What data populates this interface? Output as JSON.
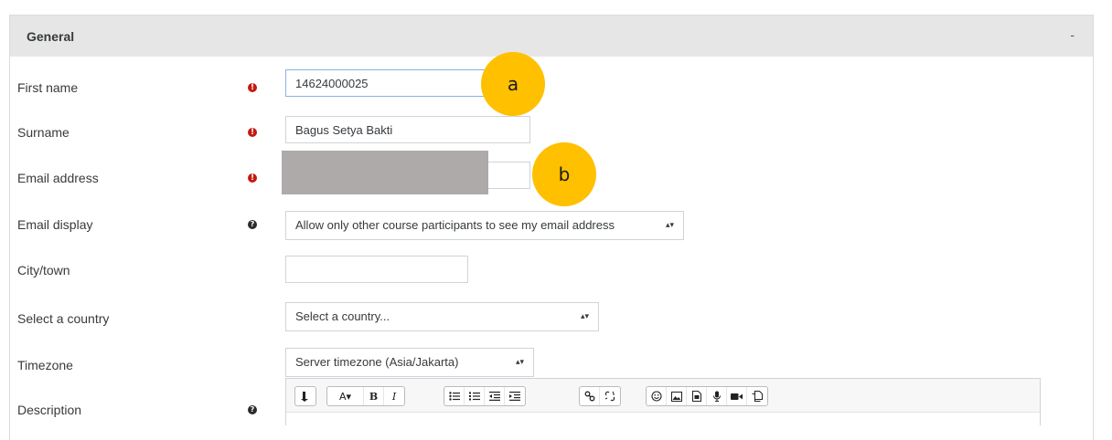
{
  "section": {
    "title": "General",
    "collapse_symbol": "-"
  },
  "fields": {
    "first_name": {
      "label": "First name",
      "value": "14624000025"
    },
    "surname": {
      "label": "Surname",
      "value": "Bagus Setya Bakti"
    },
    "email_address": {
      "label": "Email address"
    },
    "email_display": {
      "label": "Email display",
      "selected": "Allow only other course participants to see my email address"
    },
    "city": {
      "label": "City/town",
      "value": ""
    },
    "country": {
      "label": "Select a country",
      "selected": "Select a country..."
    },
    "timezone": {
      "label": "Timezone",
      "selected": "Server timezone (Asia/Jakarta)"
    },
    "description": {
      "label": "Description"
    }
  },
  "markers": {
    "required": "!",
    "help": "?",
    "select_arrows": "▴▾"
  },
  "callouts": {
    "a": "a",
    "b": "b"
  },
  "toolbar": {
    "font_color": "A▾",
    "bold": "B",
    "italic": "I"
  },
  "colors": {
    "header_bg": "#e6e6e6",
    "required_icon": "#c31a10",
    "callout": "#ffc000",
    "redaction": "#aeaaaa"
  }
}
